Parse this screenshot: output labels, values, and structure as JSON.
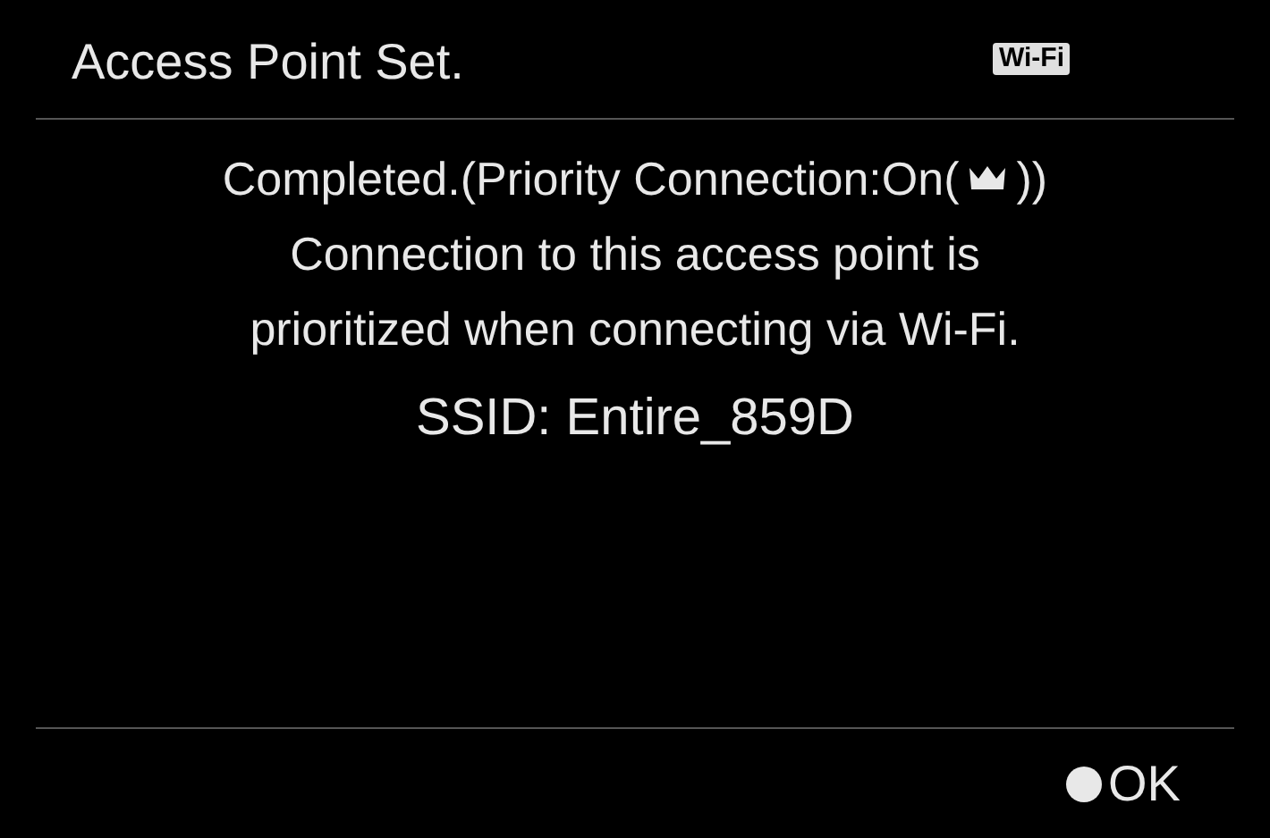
{
  "header": {
    "title": "Access Point Set.",
    "badge": "Wi-Fi"
  },
  "message": {
    "status_before_icon": "Completed.(Priority Connection:On(",
    "status_after_icon": "))",
    "lines": [
      "Connection to this access point is",
      "prioritized when connecting via Wi-Fi."
    ]
  },
  "ssid": "SSID: Entire_859D",
  "footer": {
    "button": "OK"
  }
}
